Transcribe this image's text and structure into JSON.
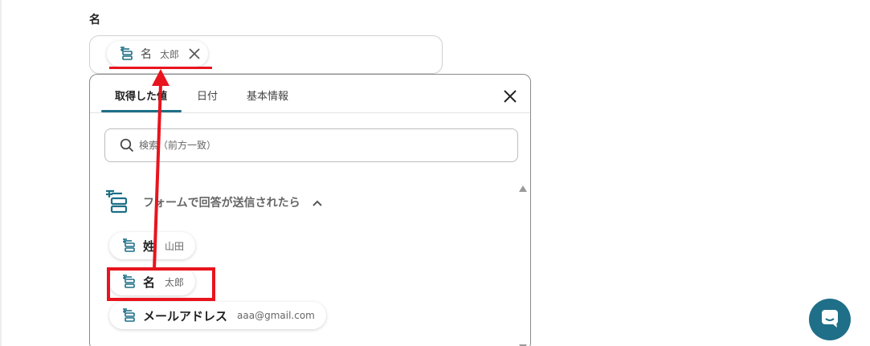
{
  "field": {
    "label": "名",
    "selected_chip": {
      "name": "名",
      "value": "太郎"
    }
  },
  "popup": {
    "tabs": [
      "取得した値",
      "日付",
      "基本情報"
    ],
    "active_tab": "取得した値",
    "search": {
      "placeholder": "検索（前方一致）",
      "value": ""
    },
    "section_title": "フォームで回答が送信されたら",
    "items": [
      {
        "name": "姓",
        "value": "山田"
      },
      {
        "name": "名",
        "value": "太郎"
      },
      {
        "name": "メールアドレス",
        "value": "aaa@gmail.com"
      }
    ]
  },
  "colors": {
    "accent": "#1e6f87",
    "annotation": "#e8141e",
    "help_button": "#1f6f88"
  },
  "icons": {
    "chip": "form-field-icon",
    "close": "close-icon",
    "search": "search-icon",
    "chevron": "chevron-up-icon",
    "help": "chat-help-icon"
  }
}
